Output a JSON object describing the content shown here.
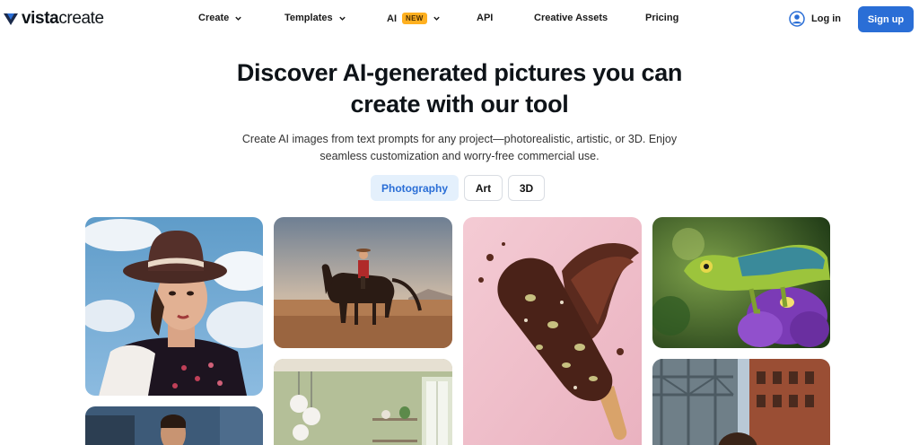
{
  "brand": {
    "name_bold": "vista",
    "name_light": "create",
    "logo_icon": "vistacreate-logo-icon"
  },
  "nav": {
    "items": [
      {
        "label": "Create",
        "has_dropdown": true
      },
      {
        "label": "Templates",
        "has_dropdown": true
      },
      {
        "label": "AI",
        "badge": "NEW",
        "has_dropdown": true
      },
      {
        "label": "API",
        "has_dropdown": false
      },
      {
        "label": "Creative Assets",
        "has_dropdown": false
      },
      {
        "label": "Pricing",
        "has_dropdown": false
      }
    ],
    "login_label": "Log in",
    "signup_label": "Sign up"
  },
  "hero": {
    "title_line1": "Discover AI-generated pictures you can",
    "title_line2": "create with our tool",
    "subtitle_line1": "Create AI images from text prompts for any project—photorealistic, artistic, or 3D. Enjoy",
    "subtitle_line2": "seamless customization and worry-free commercial use."
  },
  "tabs": [
    {
      "label": "Photography",
      "active": true
    },
    {
      "label": "Art",
      "active": false
    },
    {
      "label": "3D",
      "active": false
    }
  ],
  "gallery": [
    {
      "subject": "woman in brown hat"
    },
    {
      "subject": "rider on horse in desert"
    },
    {
      "subject": "chocolate ice cream bar splash"
    },
    {
      "subject": "chameleon on purple flower"
    },
    {
      "subject": "man in leather jacket"
    },
    {
      "subject": "interior with pendant lamps"
    },
    {
      "subject": "city street with bridge"
    }
  ],
  "colors": {
    "accent": "#2a6ed6",
    "active_tab_bg": "#e4f0fc",
    "badge_new": "#ffb020",
    "text": "#0e1318"
  }
}
